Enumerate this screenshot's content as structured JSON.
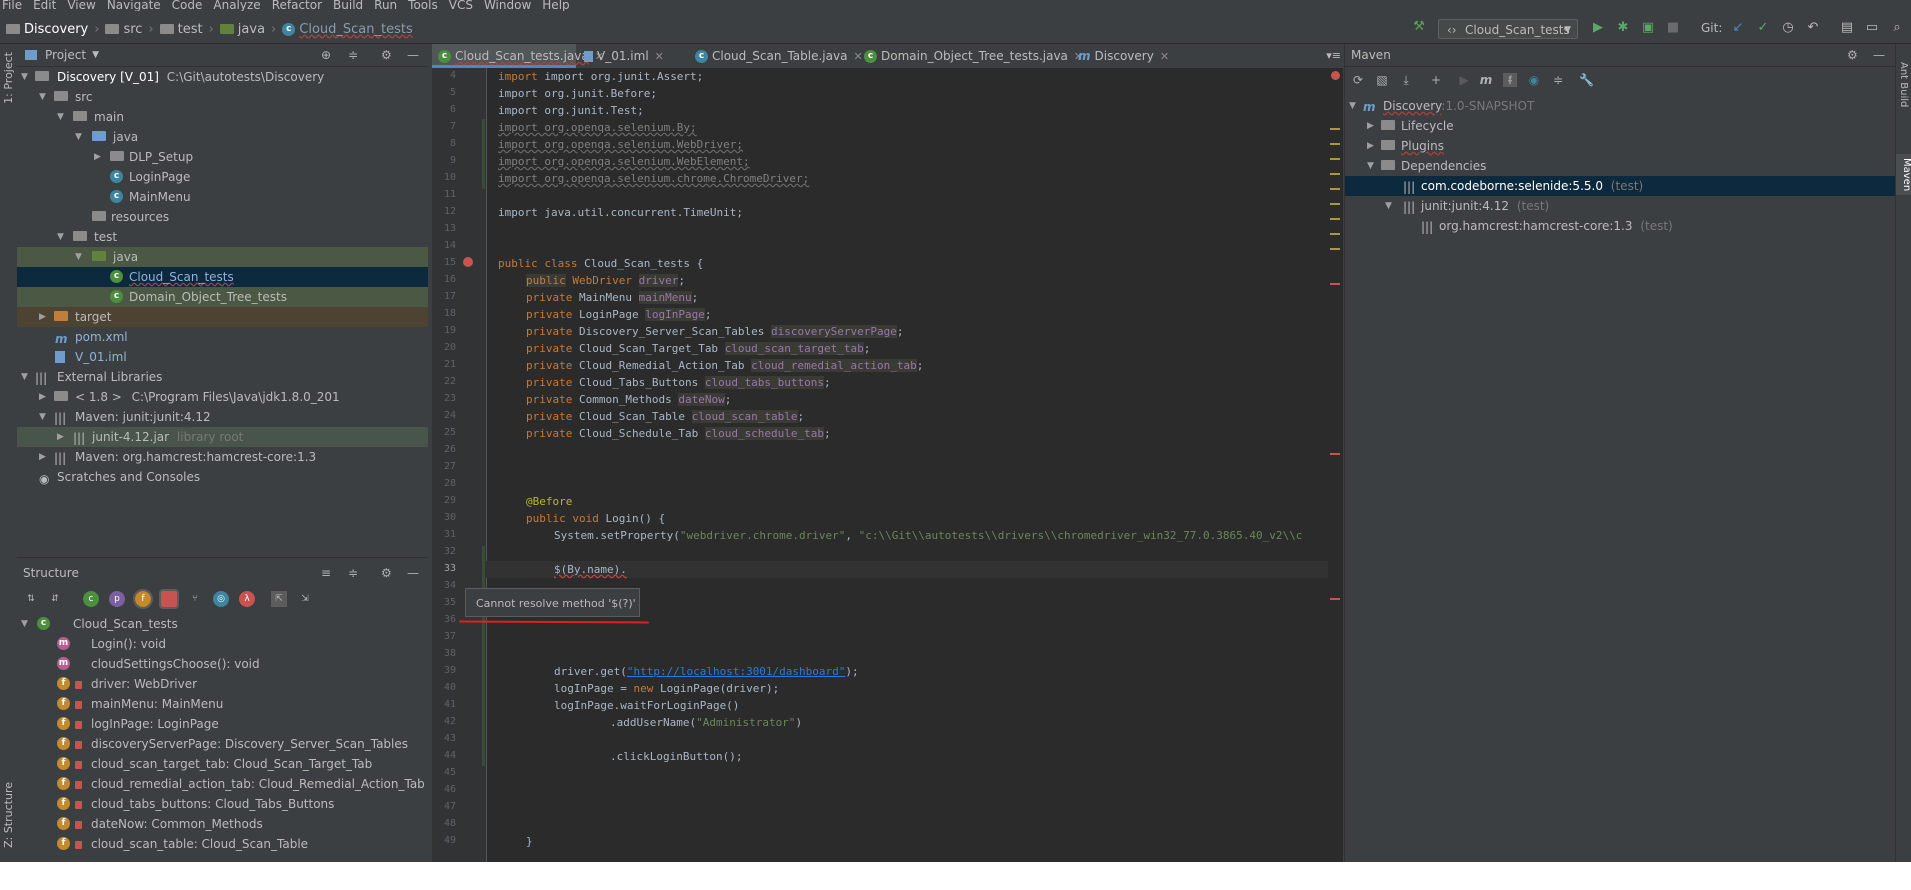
{
  "menu": [
    "File",
    "Edit",
    "View",
    "Navigate",
    "Code",
    "Analyze",
    "Refactor",
    "Build",
    "Run",
    "Tools",
    "VCS",
    "Window",
    "Help"
  ],
  "breadcrumb": [
    "Discovery",
    "src",
    "test",
    "java",
    "Cloud_Scan_tests"
  ],
  "run_config": "Cloud_Scan_tests",
  "git_label": "Git:",
  "project_panel": {
    "title": "Project",
    "tree": [
      {
        "label": "Discovery [V_01]",
        "extra": "C:\\Git\\autotests\\Discovery"
      },
      {
        "label": "src"
      },
      {
        "label": "main"
      },
      {
        "label": "java"
      },
      {
        "label": "DLP_Setup"
      },
      {
        "label": "LoginPage"
      },
      {
        "label": "MainMenu"
      },
      {
        "label": "resources"
      },
      {
        "label": "test"
      },
      {
        "label": "java"
      },
      {
        "label": "Cloud_Scan_tests"
      },
      {
        "label": "Domain_Object_Tree_tests"
      },
      {
        "label": "target"
      },
      {
        "label": "pom.xml"
      },
      {
        "label": "V_01.iml"
      },
      {
        "label": "External Libraries"
      },
      {
        "label": "< 1.8 >",
        "extra": "C:\\Program Files\\Java\\jdk1.8.0_201"
      },
      {
        "label": "Maven: junit:junit:4.12"
      },
      {
        "label": "junit-4.12.jar",
        "extra": "library root"
      },
      {
        "label": "Maven: org.hamcrest:hamcrest-core:1.3"
      },
      {
        "label": "Scratches and Consoles"
      }
    ]
  },
  "structure_panel": {
    "title": "Structure",
    "items": [
      "Cloud_Scan_tests",
      "Login(): void",
      "cloudSettingsChoose(): void",
      "driver: WebDriver",
      "mainMenu: MainMenu",
      "logInPage: LoginPage",
      "discoveryServerPage: Discovery_Server_Scan_Tables",
      "cloud_scan_target_tab: Cloud_Scan_Target_Tab",
      "cloud_remedial_action_tab: Cloud_Remedial_Action_Tab",
      "cloud_tabs_buttons: Cloud_Tabs_Buttons",
      "dateNow: Common_Methods",
      "cloud_scan_table: Cloud_Scan_Table"
    ]
  },
  "left_strip": {
    "project": "1: Project",
    "structure": "Z: Structure"
  },
  "right_strip": {
    "ant": "Ant Build",
    "maven": "Maven"
  },
  "editor_tabs": [
    "Cloud_Scan_tests.java",
    "V_01.iml",
    "Cloud_Scan_Table.java",
    "Domain_Object_Tree_tests.java",
    "Discovery"
  ],
  "line_numbers": [
    "4",
    "5",
    "6",
    "7",
    "8",
    "9",
    "10",
    "11",
    "12",
    "13",
    "14",
    "15",
    "16",
    "17",
    "18",
    "19",
    "20",
    "21",
    "22",
    "23",
    "24",
    "25",
    "26",
    "27",
    "28",
    "29",
    "30",
    "31",
    "32",
    "33",
    "34",
    "35",
    "36",
    "37",
    "38",
    "39",
    "40",
    "41",
    "42",
    "43",
    "44",
    "45",
    "46",
    "47",
    "48",
    "49"
  ],
  "code": {
    "l4": "import org.junit.Assert;",
    "l5": "import org.junit.Before;",
    "l6": "import org.junit.Test;",
    "l7": "import org.openqa.selenium.By;",
    "l8": "import org.openqa.selenium.WebDriver;",
    "l9": "import org.openqa.selenium.WebElement;",
    "l10": "import org.openqa.selenium.chrome.ChromeDriver;",
    "l12": "import java.util.concurrent.TimeUnit;",
    "l15a": "public class ",
    "l15b": "Cloud_Scan_tests {",
    "f16a": "public",
    "f16b": " WebDriver ",
    "f16c": "driver",
    "f17a": "MainMenu ",
    "f17b": "mainMenu",
    "f18a": "LoginPage ",
    "f18b": "logInPage",
    "f19a": "Discovery_Server_Scan_Tables ",
    "f19b": "discoveryServerPage",
    "f20a": "Cloud_Scan_Target_Tab ",
    "f20b": "cloud_scan_target_tab",
    "f21a": "Cloud_Remedial_Action_Tab ",
    "f21b": "cloud_remedial_action_tab",
    "f22a": "Cloud_Tabs_Buttons ",
    "f22b": "cloud_tabs_buttons",
    "f23a": "Common_Methods ",
    "f23b": "dateNow",
    "f24a": "Cloud_Scan_Table ",
    "f24b": "cloud_scan_table",
    "f25a": "Cloud_Schedule_Tab ",
    "f25b": "cloud_schedule_tab",
    "private": "private ",
    "semi": ";",
    "l29": "@Before",
    "l30a": "public void ",
    "l30b": "Login() {",
    "l31a": "System.setProperty(",
    "l31b": "\"webdriver.chrome.driver\"",
    "l31c": ", ",
    "l31d": "\"c:\\\\Git\\\\autotests\\\\drivers\\\\chromedriver_win32_77.0.3865.40_v2\\\\c",
    "l33": "$(By.name).",
    "l39a": "driver.get(",
    "l39b": "\"http://localhost:3001/dashboard\"",
    "l39c": ");",
    "l40a": "logInPage = ",
    "l40b": "new ",
    "l40c": "LoginPage(driver);",
    "l41": "logInPage.waitForLoginPage()",
    "l42a": ".addUserName(",
    "l42b": "\"Administrator\"",
    "l42c": ")",
    "l44": ".clickLoginButton();",
    "l49": "}"
  },
  "tooltip": "Cannot resolve method '$(?)'",
  "maven_panel": {
    "title": "Maven",
    "tree": [
      {
        "label": "Discovery",
        "extra": ":1.0-SNAPSHOT"
      },
      {
        "label": "Lifecycle"
      },
      {
        "label": "Plugins"
      },
      {
        "label": "Dependencies"
      },
      {
        "label": "com.codeborne:selenide:5.5.0",
        "extra": "(test)"
      },
      {
        "label": "junit:junit:4.12",
        "extra": "(test)"
      },
      {
        "label": "org.hamcrest:hamcrest-core:1.3",
        "extra": "(test)"
      }
    ]
  },
  "colors": {
    "accent": "#4a88c7",
    "background": "#3c3f41",
    "editor": "#2b2b2b",
    "error": "#e02020"
  }
}
